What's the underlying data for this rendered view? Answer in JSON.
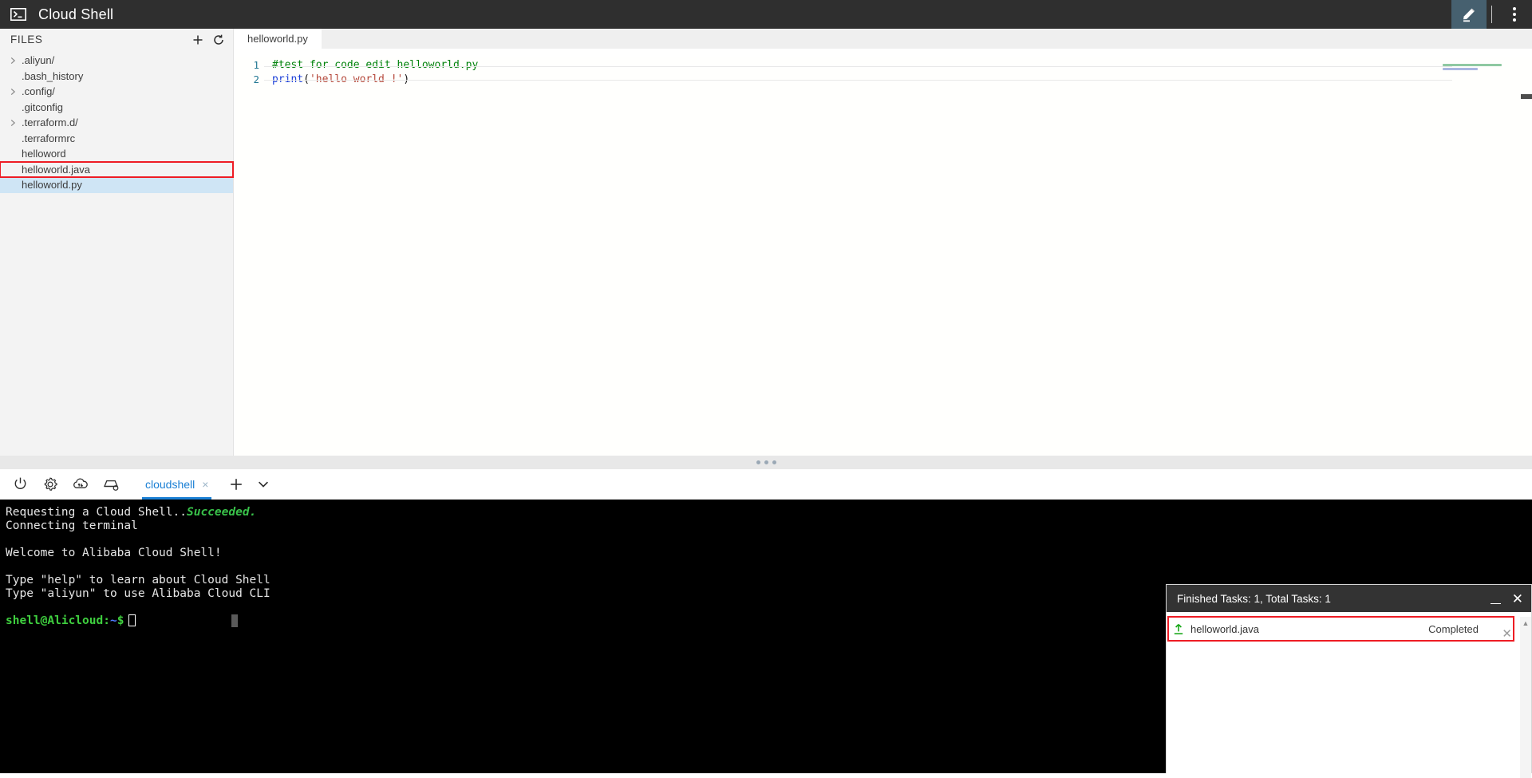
{
  "titlebar": {
    "title": "Cloud Shell",
    "app_icon": "terminal-icon",
    "edit_icon": "pencil-icon",
    "menu_icon": "more-vertical-icon"
  },
  "files_pane": {
    "header_label": "FILES",
    "add_icon": "plus-icon",
    "refresh_icon": "refresh-icon",
    "items": [
      {
        "name": ".aliyun/",
        "expandable": true,
        "selected": false,
        "annotated": false
      },
      {
        "name": ".bash_history",
        "expandable": false,
        "selected": false,
        "annotated": false
      },
      {
        "name": ".config/",
        "expandable": true,
        "selected": false,
        "annotated": false
      },
      {
        "name": ".gitconfig",
        "expandable": false,
        "selected": false,
        "annotated": false
      },
      {
        "name": ".terraform.d/",
        "expandable": true,
        "selected": false,
        "annotated": false
      },
      {
        "name": ".terraformrc",
        "expandable": false,
        "selected": false,
        "annotated": false
      },
      {
        "name": "helloword",
        "expandable": false,
        "selected": false,
        "annotated": false
      },
      {
        "name": "helloworld.java",
        "expandable": false,
        "selected": false,
        "annotated": true
      },
      {
        "name": "helloworld.py",
        "expandable": false,
        "selected": true,
        "annotated": false
      }
    ]
  },
  "editor": {
    "tab_label": "helloworld.py",
    "lines": [
      {
        "number": "1",
        "comment": "#test for code edit helloworld.py"
      },
      {
        "number": "2",
        "fn": "print",
        "open": "(",
        "string": "'hello world !'",
        "close": ")"
      }
    ]
  },
  "terminal_toolbar": {
    "icons": [
      "power-icon",
      "gear-icon",
      "cloud-transfer-icon",
      "server-upload-icon"
    ],
    "tab_label": "cloudshell",
    "tab_close": "×",
    "add_tab_icon": "plus-icon",
    "tab_menu_icon": "chevron-down-icon"
  },
  "terminal": {
    "lines": [
      {
        "text": "Requesting a Cloud Shell..",
        "highlight": "Succeeded."
      },
      {
        "text": "Connecting terminal"
      },
      {
        "text": ""
      },
      {
        "text": "Welcome to Alibaba Cloud Shell!"
      },
      {
        "text": ""
      },
      {
        "text": "Type \"help\" to learn about Cloud Shell"
      },
      {
        "text": "Type \"aliyun\" to use Alibaba Cloud CLI"
      },
      {
        "text": ""
      }
    ],
    "prompt_user": "shell@Alicloud",
    "prompt_sep": ":",
    "prompt_path": "~",
    "prompt_symbol": "$"
  },
  "upload_panel": {
    "header": "Finished Tasks: 1, Total Tasks: 1",
    "minimize_icon": "minimize-icon",
    "close_icon": "close-icon",
    "tasks": [
      {
        "upload_icon": "upload-arrow-icon",
        "name": "helloworld.java",
        "status": "Completed",
        "close": "✕"
      }
    ]
  }
}
